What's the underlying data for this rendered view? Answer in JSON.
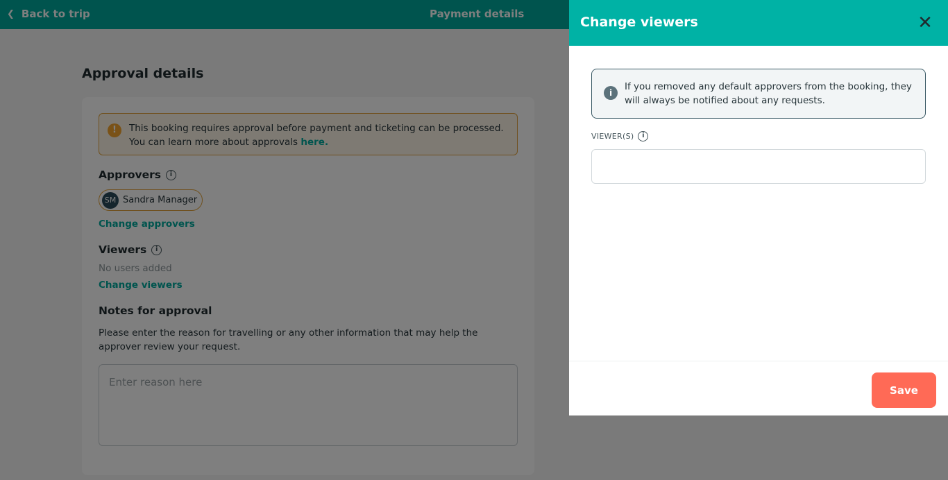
{
  "topbar": {
    "back_label": "Back to trip",
    "title": "Payment details"
  },
  "page": {
    "title": "Approval details",
    "notice_text": "This booking requires approval before payment and ticketing can be processed. You can learn more about approvals",
    "notice_link": "here.",
    "approvers_heading": "Approvers",
    "approver": {
      "initials": "SM",
      "name": "Sandra Manager"
    },
    "change_approvers": "Change approvers",
    "viewers_heading": "Viewers",
    "no_users": "No users added",
    "change_viewers": "Change viewers",
    "notes_heading": "Notes for approval",
    "notes_help": "Please enter the reason for travelling or any other information that may help the approver review your request.",
    "notes_placeholder": "Enter reason here"
  },
  "drawer": {
    "title": "Change viewers",
    "info_text": "If you removed any default approvers from the booking, they will always be notified about any requests.",
    "viewers_label": "VIEWER(S)",
    "viewers_value": "",
    "save_label": "Save"
  },
  "colors": {
    "brand": "#00a99d",
    "drawer_header": "#00b2a5",
    "save": "#ff6a56",
    "warning": "#f4a42e"
  },
  "icons": {
    "back": "chevron-left-icon",
    "warning": "warning-icon",
    "info": "info-icon",
    "close": "close-icon"
  }
}
